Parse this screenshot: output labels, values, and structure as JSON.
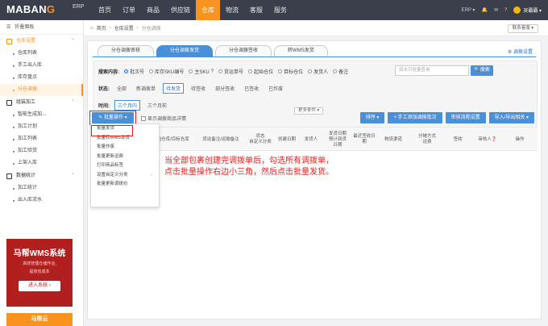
{
  "topbar": {
    "logo": "MABANG",
    "logo_erp": "ERP",
    "nav": [
      "首页",
      "订单",
      "商品",
      "供应链",
      "仓库",
      "物流",
      "客服",
      "服务"
    ],
    "active_nav": "仓库",
    "right": {
      "erp": "ERP ▾",
      "user": "吴霸霸 ▾"
    }
  },
  "sidebar": {
    "collapse": "折叠面板",
    "groups": [
      {
        "label": "仓库设置",
        "items": [
          "仓库列表",
          "手工出入库",
          "库存盘点",
          "分仓调拨"
        ]
      },
      {
        "label": "组装加工",
        "items": [
          "智能生成加...",
          "加工计划",
          "加工列表",
          "加工验货",
          "上架入库"
        ]
      },
      {
        "label": "数据统计",
        "items": [
          "加工统计",
          "出入库流水"
        ]
      }
    ],
    "active_item": "分仓调拨",
    "promo": {
      "title": "马帮WMS系统",
      "line1": "高效管理仓储作业,",
      "line2": "提效省成本",
      "button": "进入系统 ›",
      "footer": "马帮云"
    }
  },
  "breadcrumb": {
    "home": "首页",
    "level1": "仓库设置",
    "level2": "分仓调拨",
    "service": "联系客服 ▾"
  },
  "tabs": [
    "分仓调拨审核",
    "分仓调拨发货",
    "分仓调拨签收",
    "转WMS发货"
  ],
  "active_tab": "分仓调拨发货",
  "settings_link": "调拨设置",
  "filters": {
    "search_label": "搜索内容:",
    "search_options": [
      "批次号",
      "库存SKU编号",
      "主SKU",
      "货运单号",
      "起始仓位",
      "目标仓位",
      "发货人",
      "备注"
    ],
    "search_placeholder": "双击可批量查询",
    "search_button": "搜索",
    "status_label": "状态:",
    "status_options": [
      "全部",
      "新调拨单",
      "待发货",
      "待签收",
      "部分签收",
      "已签收",
      "已作废"
    ],
    "status_selected": "待发货",
    "time_label": "时间:",
    "time_options": [
      "三个月内",
      "三个月前"
    ],
    "more": "更多条件 ▾"
  },
  "actions": {
    "bulk": "批量操作",
    "show_detail": "显示调拨商品详情",
    "sort": "排序 ▾",
    "manual_add": "+ 手工添加调拨批次",
    "audit_flow": "审核流程设置",
    "import_export": "导入/导出相关 ▾"
  },
  "table_headers": [
    "起始仓库/目标仓库",
    "货运备注/运输备注",
    "状态\n自定义分类",
    "创建日期",
    "发货人",
    "发货日期\n预计到货\n日期",
    "最近签收日期",
    "物流渠道",
    "分摊方式\n运费",
    "签收",
    "审核人",
    "操作"
  ],
  "dropdown": [
    "批量发货",
    "批量转WMS发货",
    "批量作废",
    "批量更新运费",
    "打印商品标签",
    "设置自定义分类",
    "批量更新调拨价"
  ],
  "annotation": {
    "line1": "当全部包裹创建完调拨单后，勾选所有调拨单，",
    "line2": "点击批量操作右边小三角，然后点击批量发货。"
  }
}
